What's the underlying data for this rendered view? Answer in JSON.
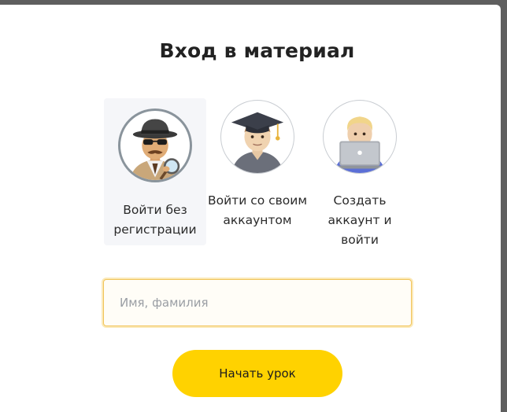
{
  "dialog": {
    "title": "Вход в материал"
  },
  "options": [
    {
      "id": "guest",
      "icon": "detective-icon",
      "label": "Войти без регистрации",
      "selected": true
    },
    {
      "id": "account",
      "icon": "graduate-icon",
      "label": "Войти со своим аккаунтом",
      "selected": false
    },
    {
      "id": "register",
      "icon": "technologist-icon",
      "label": "Создать аккаунт и войти",
      "selected": false
    }
  ],
  "name_field": {
    "value": "",
    "placeholder": "Имя, фамилия"
  },
  "start_button": {
    "label": "Начать урок"
  },
  "colors": {
    "accent": "#ffd200",
    "input_border": "#f1c45a",
    "selected_bg": "#f5f6f9",
    "overlay": "#5f5f5f"
  }
}
